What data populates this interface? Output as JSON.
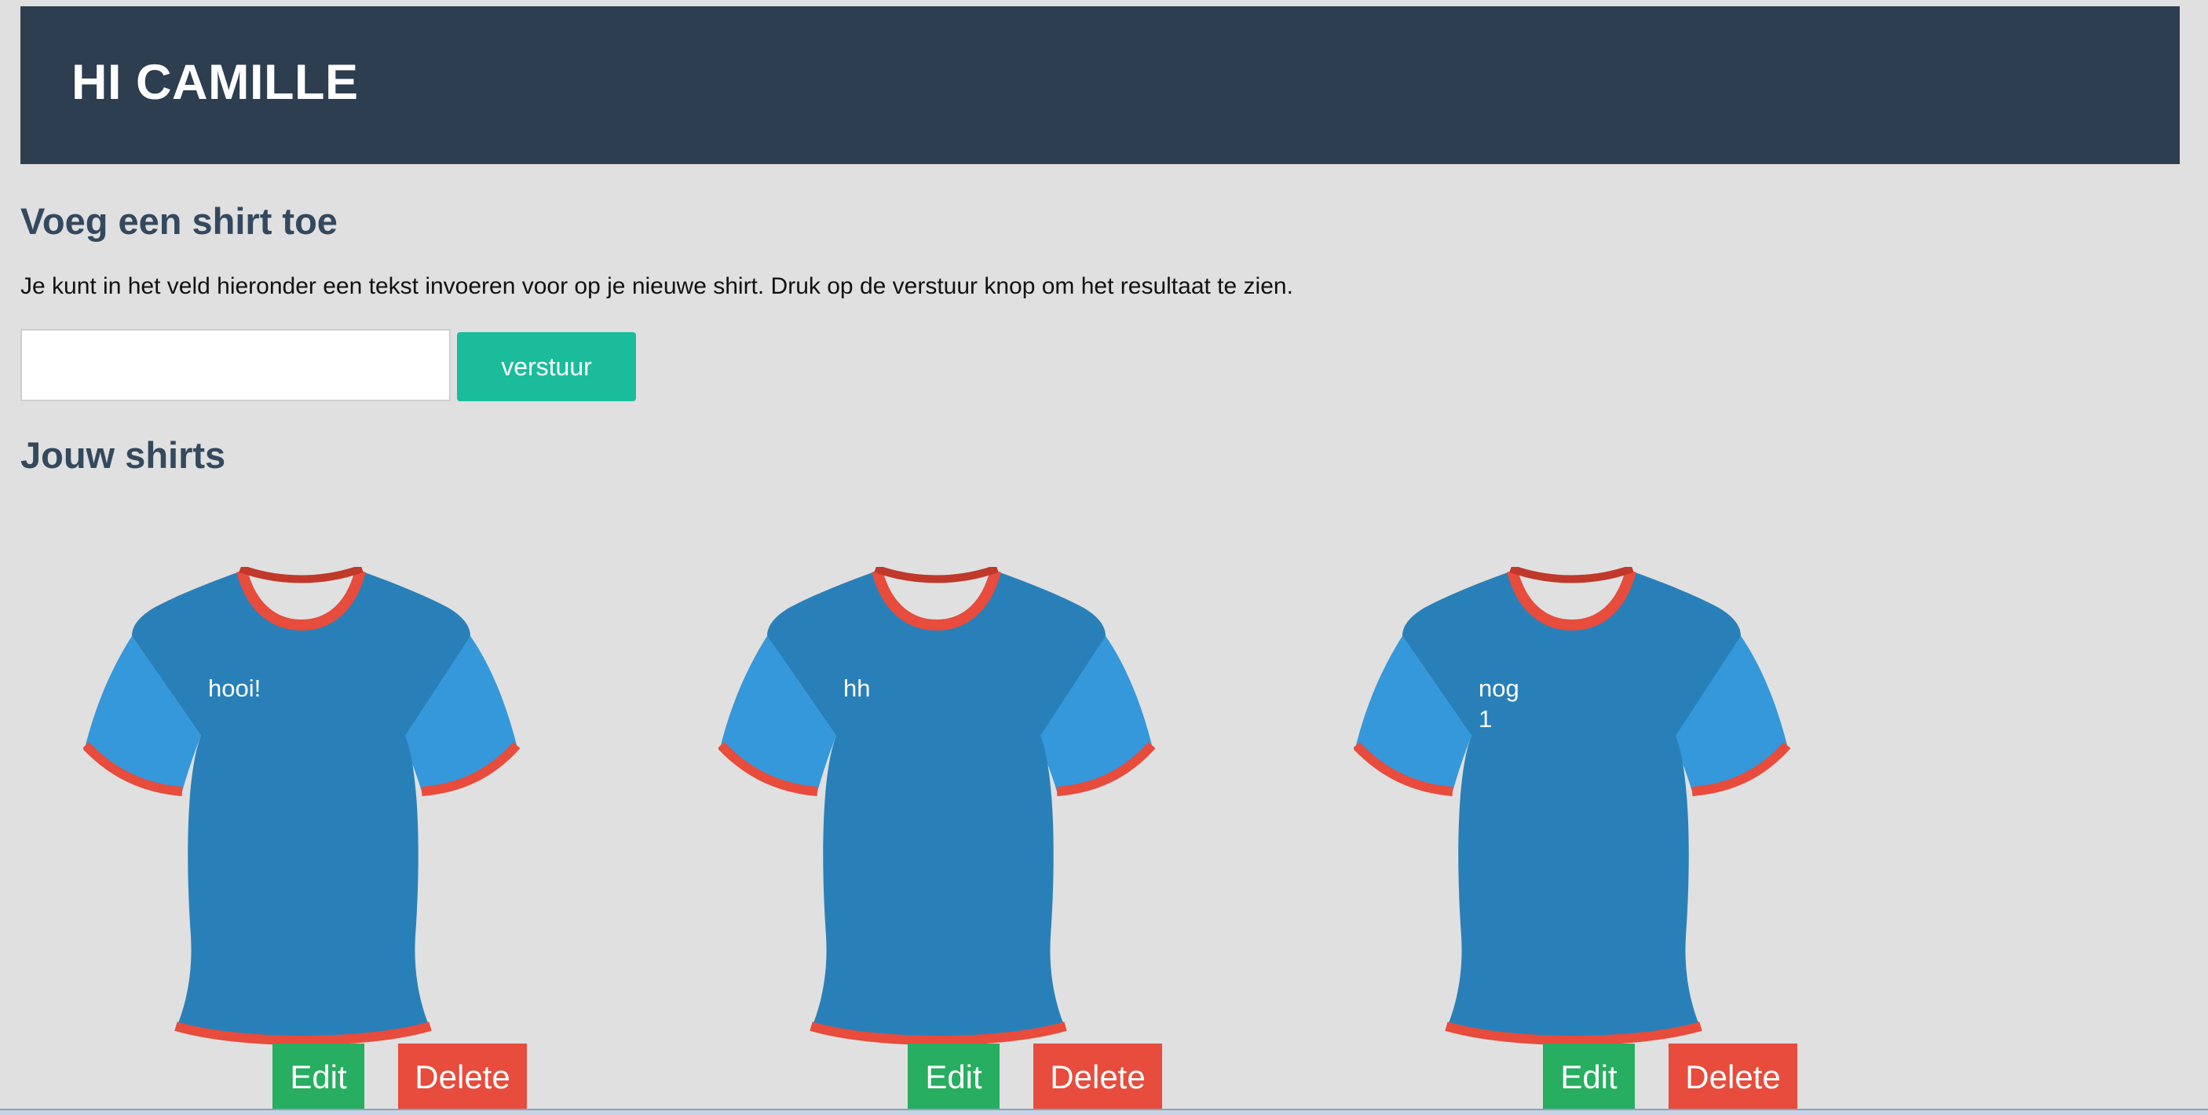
{
  "header": {
    "title": "HI CAMILLE"
  },
  "add_section": {
    "heading": "Voeg een shirt toe",
    "description": "Je kunt in het veld hieronder een tekst invoeren voor op je nieuwe shirt. Druk op de verstuur knop om het resultaat te zien.",
    "input_value": "",
    "submit_label": "verstuur"
  },
  "shirts_section": {
    "heading": "Jouw shirts",
    "shirts": [
      {
        "text": "hooi!",
        "edit_label": "Edit",
        "delete_label": "Delete"
      },
      {
        "text": "hh",
        "edit_label": "Edit",
        "delete_label": "Delete"
      },
      {
        "text": "nog 1",
        "edit_label": "Edit",
        "delete_label": "Delete"
      }
    ]
  },
  "colors": {
    "header_bg": "#2c3e50",
    "heading_text": "#34495e",
    "submit_button": "#1abc9c",
    "edit_button": "#27ae60",
    "delete_button": "#e74c3c",
    "shirt_body": "#2980b9",
    "shirt_sleeve": "#3498db",
    "shirt_trim": "#e74c3c"
  }
}
